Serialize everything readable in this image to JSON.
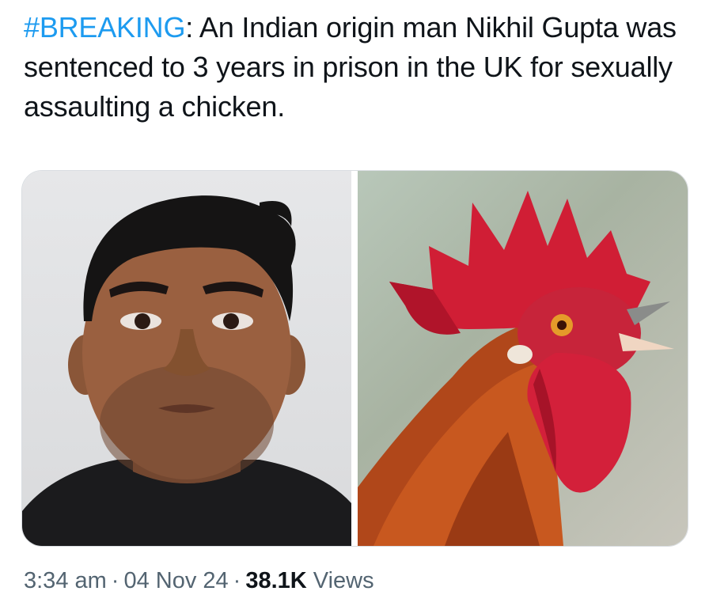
{
  "tweet": {
    "hashtag": "#BREAKING",
    "text": ": An Indian origin man Nikhil Gupta was sentenced to 3 years in prison in the UK for sexually assaulting a chicken."
  },
  "media": [
    {
      "icon": "man-mugshot-photo"
    },
    {
      "icon": "rooster-head-photo"
    }
  ],
  "meta": {
    "time": "3:34 am",
    "separator": "·",
    "date": "04 Nov 24",
    "views_count": "38.1K",
    "views_label": "Views"
  },
  "colors": {
    "hashtag": "#1d9bf0",
    "text": "#0f1419",
    "muted": "#536471"
  }
}
